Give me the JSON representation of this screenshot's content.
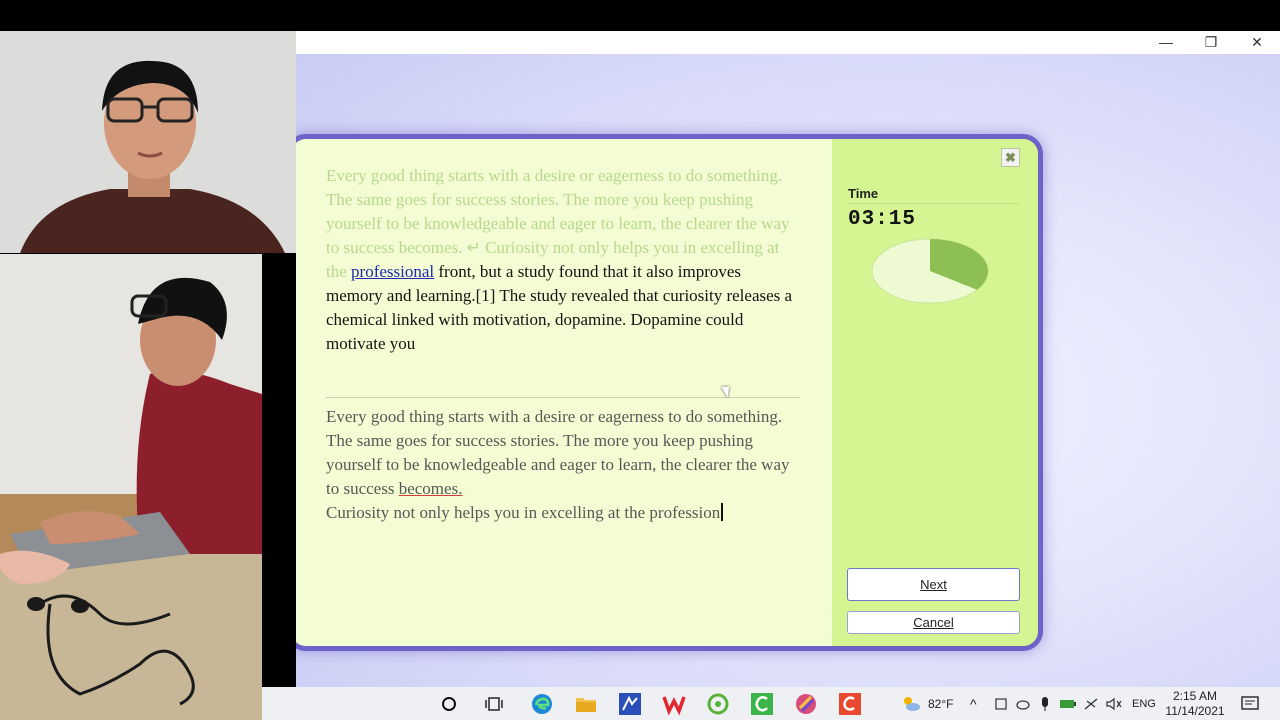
{
  "window": {
    "min_glyph": "—",
    "restore_glyph": "❐",
    "close_glyph": "✕"
  },
  "passage": {
    "done_text": "Every good thing starts with a desire or eagerness to do something. The same goes for success stories. The more you keep pushing yourself to be knowledgeable and eager to learn, the clearer the way to success becomes. ↵ Curiosity not only helps you in excelling at the ",
    "current_word": "professional",
    "remaining_text": " front, but a study found that it also improves memory and learning.[1] The study revealed that curiosity releases a chemical linked with motivation, dopamine. Dopamine could motivate you"
  },
  "typed": {
    "line1": "Every good thing starts with a desire or eagerness to do something.",
    "line2_before_error": "The same goes for success stories. The more you keep pushing yourself to be knowledgeable and eager to learn, the clearer the way to success ",
    "line2_error_word": "becomes.",
    "line3": "Curiosity not only helps you in excelling at the profession"
  },
  "timer": {
    "label": "Time",
    "value": "03:15",
    "elapsed_fraction": 0.35,
    "pie_remaining_color": "#eefbd2",
    "pie_elapsed_color": "#8dbf54"
  },
  "buttons": {
    "next_label": "Next",
    "cancel_label": "Cancel",
    "dialog_close_glyph": "✖"
  },
  "taskbar": {
    "weather_temp": "82°F",
    "language": "ENG",
    "clock_time": "2:15 AM",
    "clock_date": "11/14/2021",
    "icons": [
      "search-circle-icon",
      "task-view-icon",
      "edge-icon",
      "file-explorer-icon",
      "vsm-icon",
      "wps-icon",
      "app-icon",
      "green-app-icon",
      "color-app-icon",
      "red-app-icon"
    ]
  }
}
